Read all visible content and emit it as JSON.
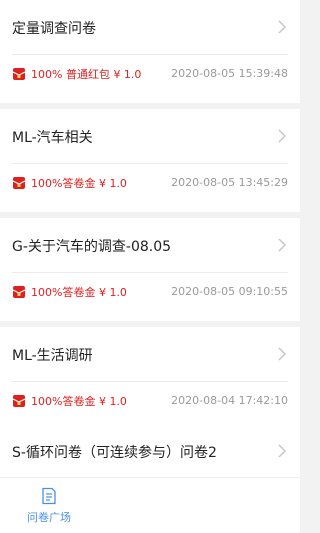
{
  "surveys": [
    {
      "title": "定量调查问卷",
      "reward": "100% 普通红包 ¥ 1.0",
      "time": "2020-08-05 15:39:48"
    },
    {
      "title": "ML-汽车相关",
      "reward": "100%答卷金 ¥ 1.0",
      "time": "2020-08-05 13:45:29"
    },
    {
      "title": "G-关于汽车的调查-08.05",
      "reward": "100%答卷金 ¥ 1.0",
      "time": "2020-08-05 09:10:55"
    },
    {
      "title": "ML-生活调研",
      "reward": "100%答卷金 ¥ 1.0",
      "time": "2020-08-04 17:42:10"
    },
    {
      "title": "S-循环问卷（可连续参与）问卷2",
      "reward": "",
      "time": ""
    }
  ],
  "tabbar": {
    "items": [
      {
        "label": "问卷广场",
        "icon": "document-icon",
        "active": true
      }
    ]
  },
  "colors": {
    "accent": "#4a90e2",
    "reward": "#e02020",
    "muted": "#9a9a9a"
  }
}
